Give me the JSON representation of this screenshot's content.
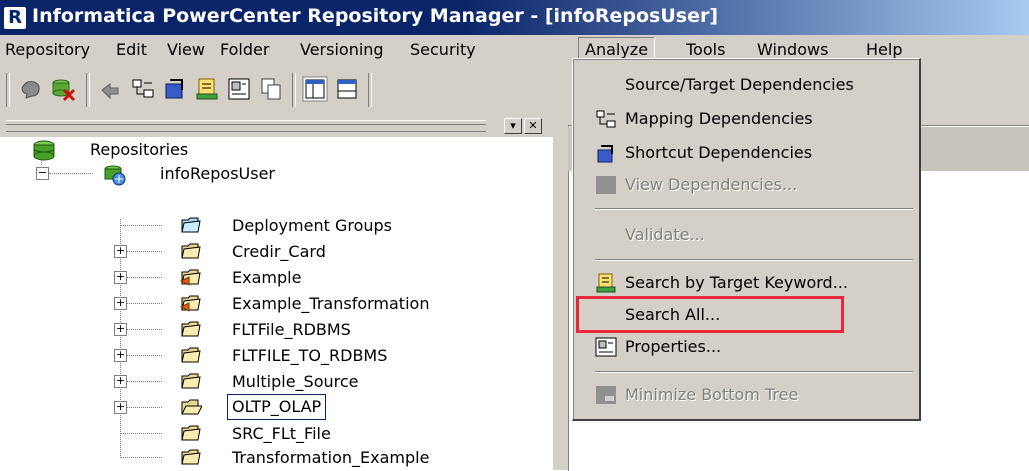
{
  "window": {
    "title": "Informatica PowerCenter Repository Manager - [infoReposUser]",
    "app_icon": "R"
  },
  "menubar": {
    "items": [
      {
        "label": "Repository"
      },
      {
        "label": "Edit"
      },
      {
        "label": "View"
      },
      {
        "label": "Folder"
      },
      {
        "label": "Versioning"
      },
      {
        "label": "Security"
      },
      {
        "label": "Analyze"
      },
      {
        "label": "Tools"
      },
      {
        "label": "Windows"
      },
      {
        "label": "Help"
      }
    ],
    "active": "Analyze"
  },
  "navigator": {
    "root": "Repositories",
    "repository": "infoReposUser",
    "folders": [
      {
        "label": "Deployment Groups",
        "expandable": false
      },
      {
        "label": "Credir_Card",
        "expandable": true
      },
      {
        "label": "Example",
        "expandable": true
      },
      {
        "label": "Example_Transformation",
        "expandable": true
      },
      {
        "label": "FLTFile_RDBMS",
        "expandable": true
      },
      {
        "label": "FLTFILE_TO_RDBMS",
        "expandable": true
      },
      {
        "label": "Multiple_Source",
        "expandable": true
      },
      {
        "label": "OLTP_OLAP",
        "expandable": true,
        "selected": true
      },
      {
        "label": "SRC_FLt_File",
        "expandable": false
      },
      {
        "label": "Transformation_Example",
        "expandable": false
      }
    ]
  },
  "analyze_menu": {
    "items": [
      {
        "label": "Source/Target Dependencies",
        "enabled": true,
        "icon": null
      },
      {
        "label": "Mapping Dependencies",
        "enabled": true,
        "icon": "mapping-dependencies-icon"
      },
      {
        "label": "Shortcut Dependencies",
        "enabled": true,
        "icon": "shortcut-dependencies-icon"
      },
      {
        "label": "View Dependencies...",
        "enabled": false,
        "icon": "view-dependencies-icon"
      },
      {
        "label": "Validate...",
        "enabled": false,
        "icon": null
      },
      {
        "label": "Search by Target Keyword...",
        "enabled": true,
        "icon": "search-keyword-icon"
      },
      {
        "label": "Search All...",
        "enabled": true,
        "icon": null,
        "highlighted": true
      },
      {
        "label": "Properties...",
        "enabled": true,
        "icon": "properties-icon"
      },
      {
        "label": "Minimize Bottom Tree",
        "enabled": false,
        "icon": "minimize-tree-icon"
      }
    ]
  },
  "colors": {
    "titlebar": "#0a246a",
    "highlight": "#e8283a",
    "chrome": "#d4d0c8"
  }
}
